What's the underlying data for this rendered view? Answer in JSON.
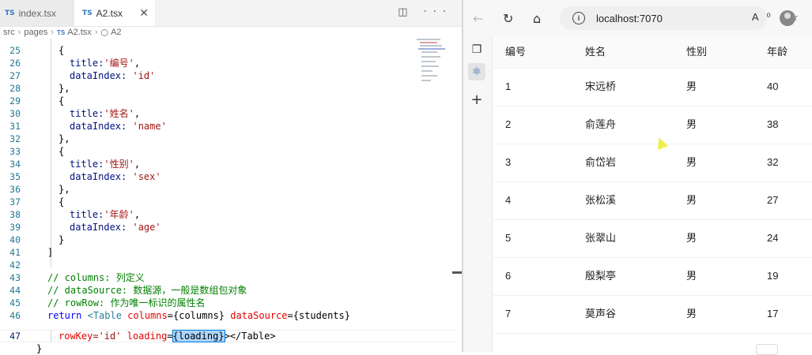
{
  "editor": {
    "tabs": [
      {
        "icon": "TS",
        "label": "index.tsx"
      },
      {
        "icon": "TS",
        "label": "A2.tsx",
        "close": "✕"
      }
    ],
    "actions": "◫ ···",
    "breadcrumb": [
      "src",
      "pages",
      "A2.tsx",
      "A2"
    ],
    "lines": [
      {
        "n": "25"
      },
      {
        "n": "26"
      },
      {
        "n": "27"
      },
      {
        "n": "28"
      },
      {
        "n": "29"
      },
      {
        "n": "30"
      },
      {
        "n": "31"
      },
      {
        "n": "32"
      },
      {
        "n": "33"
      },
      {
        "n": "34"
      },
      {
        "n": "35"
      },
      {
        "n": "36"
      },
      {
        "n": "37"
      },
      {
        "n": "38"
      },
      {
        "n": "39"
      },
      {
        "n": "40"
      },
      {
        "n": "41"
      },
      {
        "n": "42"
      },
      {
        "n": "43"
      },
      {
        "n": "44"
      },
      {
        "n": "45"
      },
      {
        "n": "46"
      },
      {
        "n": "47"
      }
    ],
    "code": {
      "open_brace": "{",
      "close_brace_comma": "},",
      "close_brace": "}",
      "close_bracket": "]",
      "title_key": "title:",
      "dataindex_key": "dataIndex:",
      "titles": [
        "'编号'",
        "'姓名'",
        "'性别'",
        "'年龄'"
      ],
      "indexes": [
        "'id'",
        "'name'",
        "'sex'",
        "'age'"
      ],
      "comma": ",",
      "c43": "// columns: 列定义",
      "c44": "// dataSource: 数据源，一般是数组包对象",
      "c45": "// rowRow: 作为唯一标识的属性名",
      "l46_return": "return",
      "l46_tag": "<Table",
      "l46_attr1": "columns",
      "l46_val1": "={columns}",
      "l46_attr2": "dataSource",
      "l46_val2": "={students}",
      "l47_attr1": "rowKey",
      "l47_val1": "='id'",
      "l47_attr2": "loading",
      "l47_eq": "=",
      "l47_hl": "{loading}",
      "l47_end": "></Table>",
      "last": "}"
    }
  },
  "browser": {
    "url": "localhost:7070",
    "info_icon": "i",
    "url_right": "A⁰ ☆",
    "sidebar_icons": [
      "❐",
      "⚛",
      "+"
    ],
    "table": {
      "columns": [
        "编号",
        "姓名",
        "性别",
        "年龄"
      ],
      "rows": [
        [
          "1",
          "宋远桥",
          "男",
          "40"
        ],
        [
          "2",
          "俞莲舟",
          "男",
          "38"
        ],
        [
          "3",
          "俞岱岩",
          "男",
          "32"
        ],
        [
          "4",
          "张松溪",
          "男",
          "27"
        ],
        [
          "5",
          "张翠山",
          "男",
          "24"
        ],
        [
          "6",
          "殷梨亭",
          "男",
          "19"
        ],
        [
          "7",
          "莫声谷",
          "男",
          "17"
        ]
      ]
    }
  }
}
